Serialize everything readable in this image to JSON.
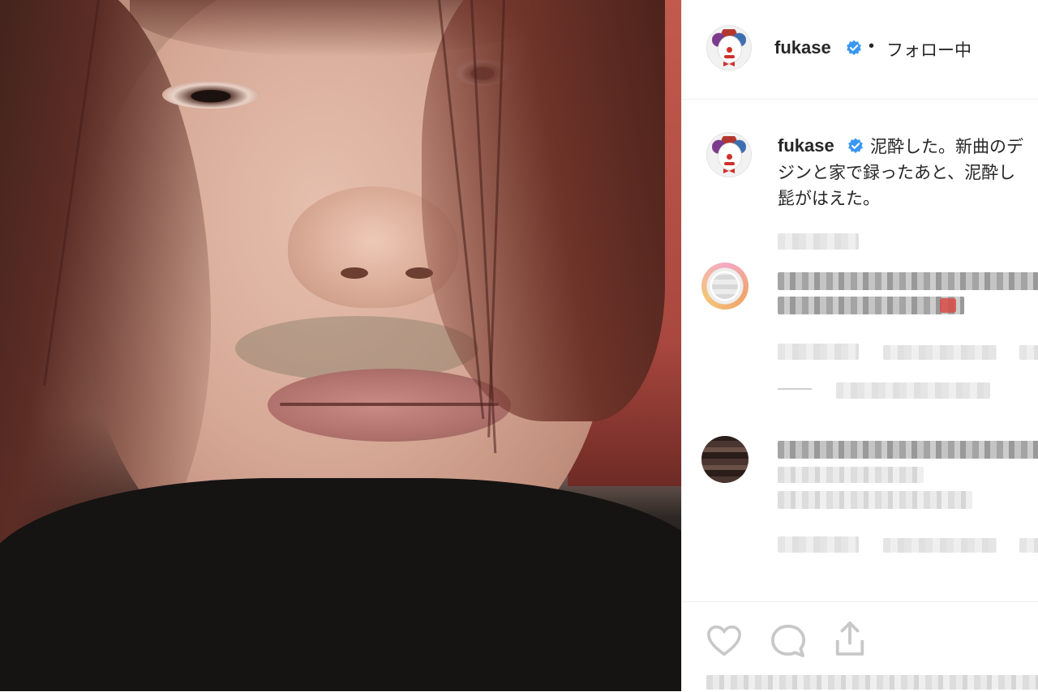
{
  "post": {
    "author": "fukase",
    "follow_status": "フォロー中",
    "separator": "•",
    "caption_lines": [
      "泥酔した。新曲のデ",
      "ジンと家で録ったあと、泥酔し",
      "髭がはえた。"
    ]
  },
  "colors": {
    "verified_blue": "#3897f0",
    "text": "#262626",
    "divider": "#efefef"
  },
  "icons": {
    "verified": "verified-badge-icon",
    "like": "heart-icon",
    "comment": "comment-icon",
    "share": "share-icon"
  }
}
